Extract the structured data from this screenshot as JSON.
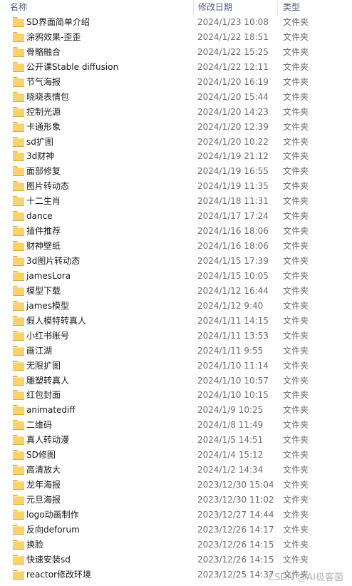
{
  "header": {
    "name": "名称",
    "date": "修改日期",
    "type": "类型"
  },
  "icon": "folder-icon",
  "rows": [
    {
      "name": "SD界面简单介绍",
      "date": "2024/1/23 10:08",
      "type": "文件夹"
    },
    {
      "name": "涂鸦效果-歪歪",
      "date": "2024/1/22 18:51",
      "type": "文件夹"
    },
    {
      "name": "骨骼融合",
      "date": "2024/1/22 15:25",
      "type": "文件夹"
    },
    {
      "name": "公开课Stable diffusion",
      "date": "2024/1/22 12:11",
      "type": "文件夹"
    },
    {
      "name": "节气海报",
      "date": "2024/1/20 16:19",
      "type": "文件夹"
    },
    {
      "name": "晓晓表情包",
      "date": "2024/1/20 15:44",
      "type": "文件夹"
    },
    {
      "name": "控制光源",
      "date": "2024/1/20 14:23",
      "type": "文件夹"
    },
    {
      "name": "卡通形象",
      "date": "2024/1/20 12:39",
      "type": "文件夹"
    },
    {
      "name": "sd扩图",
      "date": "2024/1/20 10:22",
      "type": "文件夹"
    },
    {
      "name": "3d财神",
      "date": "2024/1/19 21:12",
      "type": "文件夹"
    },
    {
      "name": "面部修复",
      "date": "2024/1/19 16:55",
      "type": "文件夹"
    },
    {
      "name": "图片转动态",
      "date": "2024/1/19 11:35",
      "type": "文件夹"
    },
    {
      "name": "十二生肖",
      "date": "2024/1/18 11:31",
      "type": "文件夹"
    },
    {
      "name": "dance",
      "date": "2024/1/17 17:24",
      "type": "文件夹"
    },
    {
      "name": "插件推荐",
      "date": "2024/1/16 18:06",
      "type": "文件夹"
    },
    {
      "name": "财神壁纸",
      "date": "2024/1/16 18:06",
      "type": "文件夹"
    },
    {
      "name": "3d图片转动态",
      "date": "2024/1/15 17:39",
      "type": "文件夹"
    },
    {
      "name": "jamesLora",
      "date": "2024/1/15 10:05",
      "type": "文件夹"
    },
    {
      "name": "模型下载",
      "date": "2024/1/12 16:44",
      "type": "文件夹"
    },
    {
      "name": "james模型",
      "date": "2024/1/12 9:40",
      "type": "文件夹"
    },
    {
      "name": "假人模特转真人",
      "date": "2024/1/11 14:15",
      "type": "文件夹"
    },
    {
      "name": "小红书账号",
      "date": "2024/1/11 13:53",
      "type": "文件夹"
    },
    {
      "name": "画江湖",
      "date": "2024/1/11 9:55",
      "type": "文件夹"
    },
    {
      "name": "无限扩图",
      "date": "2024/1/10 11:14",
      "type": "文件夹"
    },
    {
      "name": "雕塑转真人",
      "date": "2024/1/10 10:57",
      "type": "文件夹"
    },
    {
      "name": "红包封面",
      "date": "2024/1/10 10:15",
      "type": "文件夹"
    },
    {
      "name": "animatediff",
      "date": "2024/1/9 10:25",
      "type": "文件夹"
    },
    {
      "name": "二维码",
      "date": "2024/1/8 11:49",
      "type": "文件夹"
    },
    {
      "name": "真人转动漫",
      "date": "2024/1/5 14:51",
      "type": "文件夹"
    },
    {
      "name": "SD修图",
      "date": "2024/1/4 15:12",
      "type": "文件夹"
    },
    {
      "name": "高清放大",
      "date": "2024/1/2 14:34",
      "type": "文件夹"
    },
    {
      "name": "龙年海报",
      "date": "2023/12/30 15:04",
      "type": "文件夹"
    },
    {
      "name": "元旦海报",
      "date": "2023/12/30 11:02",
      "type": "文件夹"
    },
    {
      "name": "logo动画制作",
      "date": "2023/12/27 14:44",
      "type": "文件夹"
    },
    {
      "name": "反向deforum",
      "date": "2023/12/26 14:17",
      "type": "文件夹"
    },
    {
      "name": "换脸",
      "date": "2023/12/26 14:15",
      "type": "文件夹"
    },
    {
      "name": "快速安装sd",
      "date": "2023/12/26 14:15",
      "type": "文件夹"
    },
    {
      "name": "reactor修改环境",
      "date": "2023/12/25 14:37",
      "type": "文件夹"
    }
  ],
  "watermark": "CSDN @AI极客菌"
}
